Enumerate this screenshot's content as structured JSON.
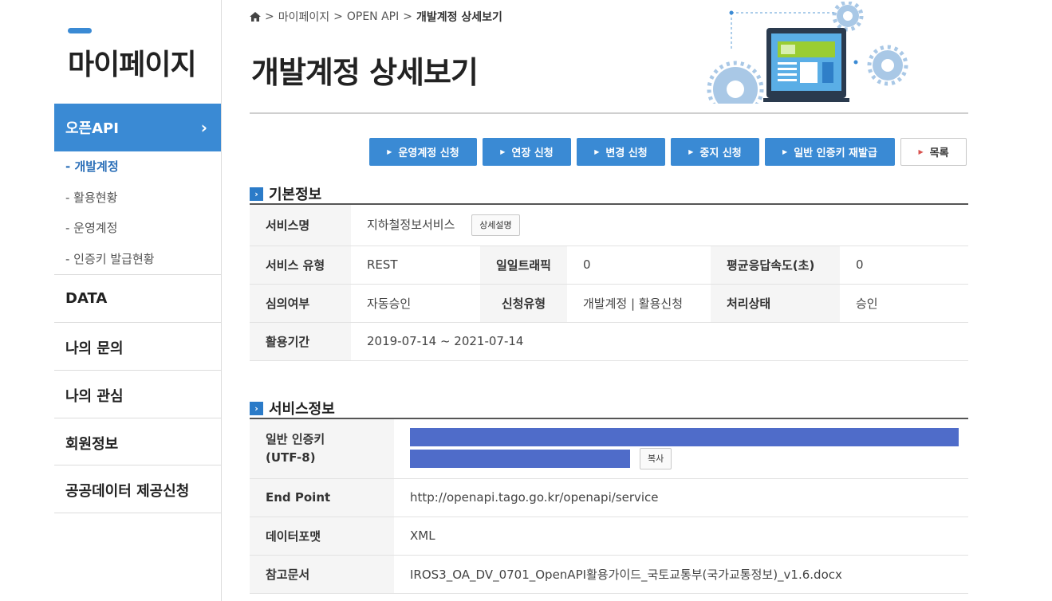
{
  "sidebar": {
    "title": "마이페이지",
    "active_menu": {
      "label": "오픈API",
      "chevron": "›"
    },
    "sub_items": [
      {
        "label": "- 개발계정",
        "active": true
      },
      {
        "label": "- 활용현황",
        "active": false
      },
      {
        "label": "- 운영계정",
        "active": false
      },
      {
        "label": "- 인증키 발급현황",
        "active": false
      }
    ],
    "menu_items": [
      {
        "label": "DATA"
      },
      {
        "label": "나의 문의"
      },
      {
        "label": "나의 관심"
      },
      {
        "label": "회원정보"
      },
      {
        "label": "공공데이터 제공신청"
      }
    ]
  },
  "breadcrumb": {
    "items": [
      "마이페이지",
      "OPEN API",
      "개발계정 상세보기"
    ],
    "separator": ">"
  },
  "page_title": "개발계정 상세보기",
  "actions": [
    {
      "label": "운영계정 신청"
    },
    {
      "label": "연장 신청"
    },
    {
      "label": "변경 신청"
    },
    {
      "label": "중지 신청"
    },
    {
      "label": "일반 인증키 재발급"
    },
    {
      "label": "목록"
    }
  ],
  "basic_info": {
    "heading": "기본정보",
    "service_name_label": "서비스명",
    "service_name": "지하철정보서비스",
    "detail_button": "상세설명",
    "service_type_label": "서비스 유형",
    "service_type": "REST",
    "daily_traffic_label": "일일트래픽",
    "daily_traffic": "0",
    "avg_response_label": "평균응답속도(초)",
    "avg_response": "0",
    "review_label": "심의여부",
    "review": "자동승인",
    "request_type_label": "신청유형",
    "request_type": "개발계정 | 활용신청",
    "status_label": "처리상태",
    "status": "승인",
    "period_label": "활용기간",
    "period": "2019-07-14 ~ 2021-07-14"
  },
  "service_info": {
    "heading": "서비스정보",
    "key_label": "일반 인증키",
    "key_label_sub": "(UTF-8)",
    "copy_button": "복사",
    "endpoint_label": "End Point",
    "endpoint": "http://openapi.tago.go.kr/openapi/service",
    "format_label": "데이터포맷",
    "format": "XML",
    "doc_label": "참고문서",
    "doc": "IROS3_OA_DV_0701_OpenAPI활용가이드_국토교통부(국가교통정보)_v1.6.docx"
  },
  "colors": {
    "accent": "#3a8ad4",
    "key_redaction": "#4f6cc9"
  },
  "icons": {
    "home": "home-icon",
    "section": "arrow-right-square-icon",
    "button": "triangle-right-icon"
  }
}
